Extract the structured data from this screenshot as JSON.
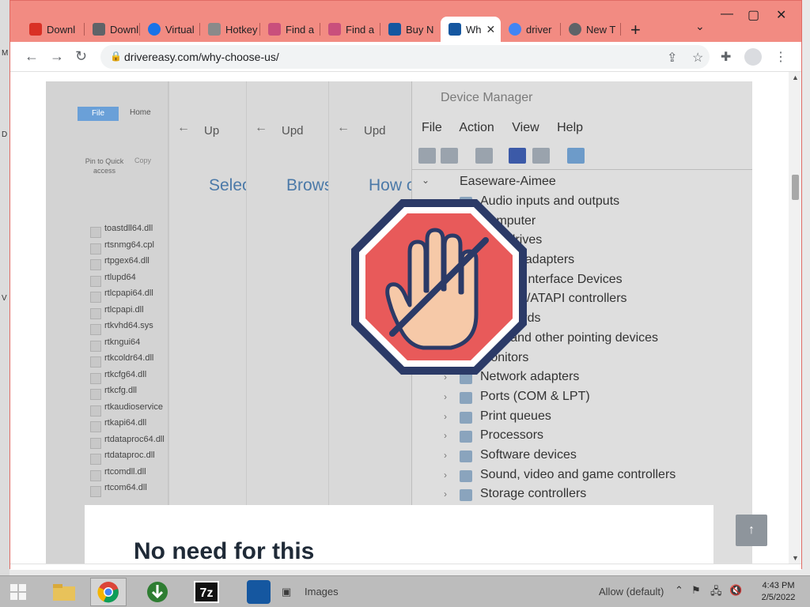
{
  "browser": {
    "tabs": [
      {
        "label": "Downl",
        "color": "#d93025"
      },
      {
        "label": "Downl",
        "color": "#5f6368"
      },
      {
        "label": "Virtual",
        "color": "#1a73e8"
      },
      {
        "label": "Hotkey",
        "color": "#8a8a8a"
      },
      {
        "label": "Find a",
        "color": "#c94f7c"
      },
      {
        "label": "Find a",
        "color": "#c94f7c"
      },
      {
        "label": "Buy N",
        "color": "#1557a0"
      },
      {
        "label": "Wh",
        "color": "#1557a0"
      },
      {
        "label": "driver",
        "color": "#4285f4"
      },
      {
        "label": "New T",
        "color": "#5f6368"
      }
    ],
    "active_tab_index": 7,
    "url": "drivereasy.com/why-choose-us/",
    "accent_color": "#f28b82"
  },
  "article_image": {
    "explorer": {
      "file_tab": "File",
      "home_tab": "Home",
      "pin_label": "Pin to Quick access",
      "copy_label": "Copy",
      "files": [
        "toastdll64.dll",
        "rtsnmg64.cpl",
        "rtpgex64.dll",
        "rtlupd64",
        "rtlcpapi64.dll",
        "rtlcpapi.dll",
        "rtkvhd64.sys",
        "rtkngui64",
        "rtkcoldr64.dll",
        "rtkcfg64.dll",
        "rtkcfg.dll",
        "rtkaudioservice",
        "rtkapi64.dll",
        "rtdataproc64.dll",
        "rtdataproc.dll",
        "rtcomdll.dll",
        "rtcom64.dll"
      ]
    },
    "wizards": [
      {
        "title": "Up",
        "big": "Selec"
      },
      {
        "title": "Upd",
        "big": "Brows"
      },
      {
        "title": "Upd",
        "big": "How c"
      }
    ],
    "device_manager": {
      "title": "Device Manager",
      "menu": [
        "File",
        "Action",
        "View",
        "Help"
      ],
      "root": "Easeware-Aimee",
      "items": [
        "Audio inputs and outputs",
        "Computer",
        "Disk drives",
        "Display adapters",
        "Human Interface Devices",
        "IDE ATA/ATAPI controllers",
        "Keyboards",
        "Mice and other pointing devices",
        "Monitors",
        "Network adapters",
        "Ports (COM & LPT)",
        "Print queues",
        "Processors",
        "Software devices",
        "Sound, video and game controllers",
        "Storage controllers"
      ]
    }
  },
  "card": {
    "heading": "No need for this"
  },
  "to_top_icon": "arrow-up-icon",
  "taskbar": {
    "items_label": "Images",
    "tray_text": "Allow (default)",
    "time": "4:43 PM",
    "date": "2/5/2022"
  }
}
